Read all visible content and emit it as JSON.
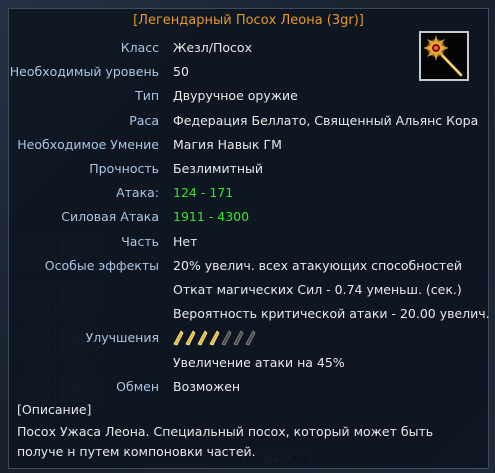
{
  "item": {
    "title": "[Легендарный Посох Леона (3gr)]",
    "icon": "golden-staff-icon"
  },
  "rows": [
    {
      "label": "Класс",
      "value": "Жезл/Посох"
    },
    {
      "label": "Необходимый уровень",
      "value": "50"
    },
    {
      "label": "Тип",
      "value": "Двуручное оружие"
    },
    {
      "label": "Раса",
      "value": "Федерация Беллато, Священный Альянс Кора"
    },
    {
      "label": "Необходимое Умение",
      "value": "Магия Навык ГМ"
    },
    {
      "label": "Прочность",
      "value": "Безлимитный"
    },
    {
      "label": "Атака:",
      "value": "124 - 171",
      "color": "#35e62e"
    },
    {
      "label": "Силовая Атака",
      "value": "1911 - 4300",
      "color": "#35e62e"
    },
    {
      "label": "Часть",
      "value": "Нет"
    },
    {
      "label": "Особые эффекты",
      "value": "20% увелич. всех атакующих способностей"
    },
    {
      "label": "",
      "value": "Откат магических Сил - 0.74 уменьш. (сек.)"
    },
    {
      "label": "",
      "value": "Вероятность критической атаки - 20.00 увелич."
    },
    {
      "label": "Улучшения",
      "value": ""
    },
    {
      "label": "",
      "value": "Увеличение атаки на 45%"
    },
    {
      "label": "Обмен",
      "value": "Возможен"
    }
  ],
  "upgrades": {
    "filled": 4,
    "total": 7,
    "icon": "upgrade-talic-icon"
  },
  "description": {
    "header": "[Описание]",
    "text": "Посох Ужаса Леона. Специальный посох, который может быть получе н путем компоновки частей."
  },
  "colors": {
    "title": "#e39a2a",
    "label": "#a9c6e4",
    "value": "#e8e8e8",
    "stat": "#35e62e"
  }
}
